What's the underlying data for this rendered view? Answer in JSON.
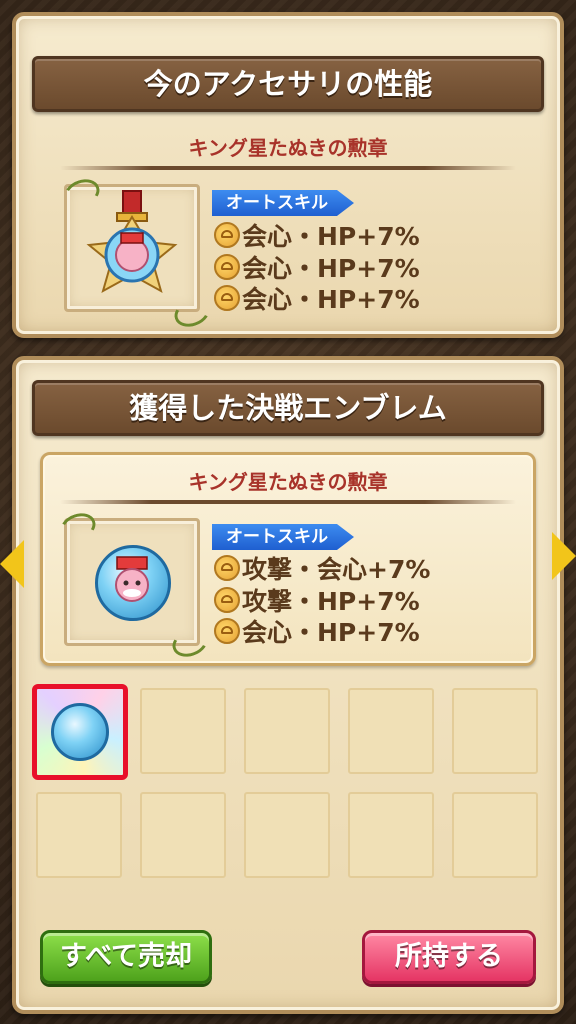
{
  "current_section": {
    "title": "今のアクセサリの性能",
    "item_name": "キング星たぬきの勲章",
    "skill_tag": "オートスキル",
    "skills": [
      "会心・HP+7%",
      "会心・HP+7%",
      "会心・HP+7%"
    ],
    "icon": "medal-icon"
  },
  "acquired_section": {
    "title": "獲得した決戦エンブレム",
    "item_name": "キング星たぬきの勲章",
    "skill_tag": "オートスキル",
    "skills": [
      "攻撃・会心+7%",
      "攻撃・HP+7%",
      "会心・HP+7%"
    ],
    "icon": "emblem-icon"
  },
  "grid": {
    "slot_count": 10,
    "selected_index": 0
  },
  "buttons": {
    "sell_all": "すべて売却",
    "keep": "所持する"
  },
  "colors": {
    "item_name": "#a8332a",
    "skill_tag": "#2a6fe0",
    "sell_button": "#5cb82a",
    "keep_button": "#ee4a74",
    "selected_border": "#e8102a",
    "arrow": "#f2c51a"
  }
}
